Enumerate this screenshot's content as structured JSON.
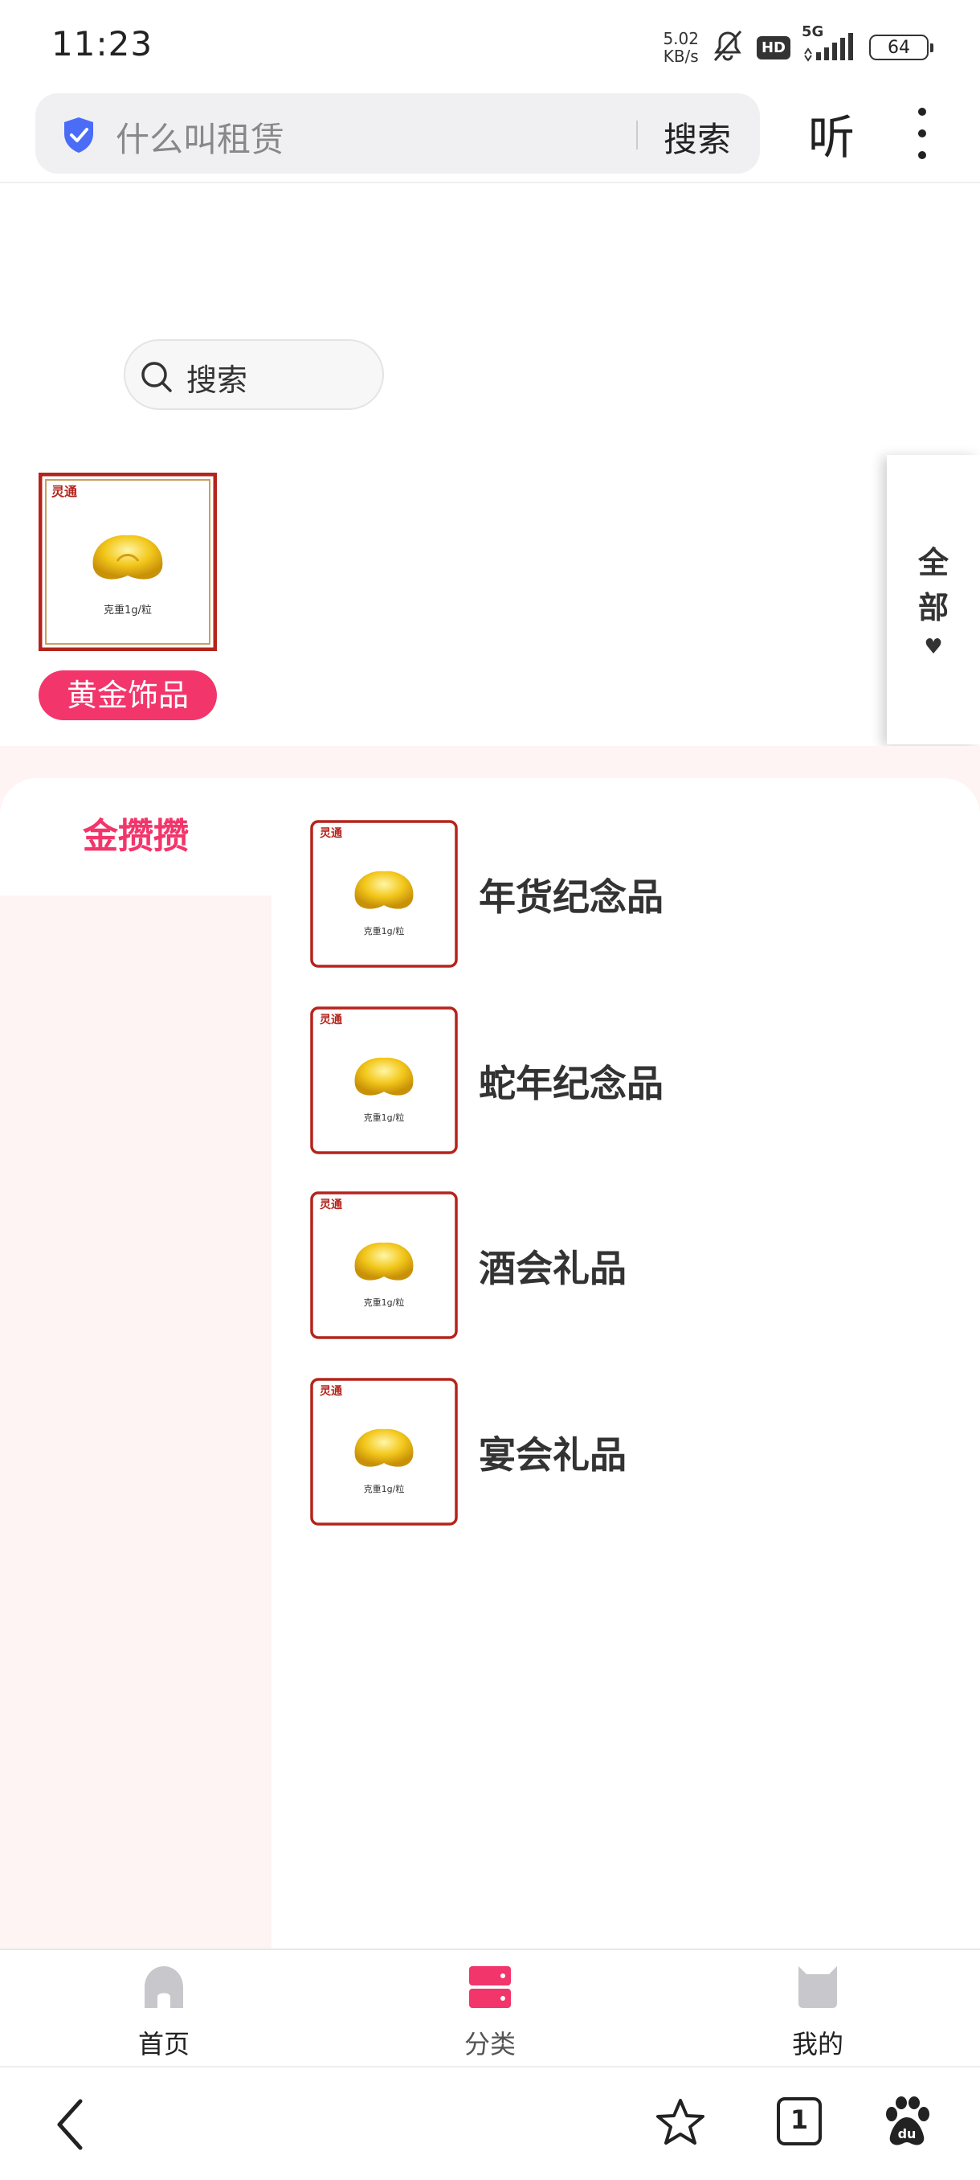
{
  "status_bar": {
    "time": "11:23",
    "net_speed_value": "5.02",
    "net_speed_unit": "KB/s",
    "network": "5G",
    "hd": "HD",
    "battery": "64"
  },
  "browser": {
    "url_text": "什么叫租赁",
    "search_label": "搜索",
    "listen_label": "听"
  },
  "page_search": {
    "placeholder": "搜索"
  },
  "top_category": {
    "label": "黄金饰品",
    "image_brand": "灵通",
    "image_caption": "克重1g/粒"
  },
  "all_tab": {
    "label": "全部"
  },
  "left_nav": {
    "items": [
      {
        "label": "金攒攒",
        "active": true
      }
    ]
  },
  "sub_categories": [
    {
      "label": "年货纪念品",
      "brand": "灵通",
      "caption": "克重1g/粒"
    },
    {
      "label": "蛇年纪念品",
      "brand": "灵通",
      "caption": "克重1g/粒"
    },
    {
      "label": "酒会礼品",
      "brand": "灵通",
      "caption": "克重1g/粒"
    },
    {
      "label": "宴会礼品",
      "brand": "灵通",
      "caption": "克重1g/粒"
    }
  ],
  "tab_bar": {
    "tabs": [
      {
        "label": "首页",
        "active": false
      },
      {
        "label": "分类",
        "active": true
      },
      {
        "label": "我的",
        "active": false
      }
    ],
    "accent_color": "#f2356b"
  },
  "browser_nav": {
    "tab_count": "1"
  },
  "colors": {
    "accent": "#f2356b",
    "panel_tint": "#fff4f4"
  }
}
